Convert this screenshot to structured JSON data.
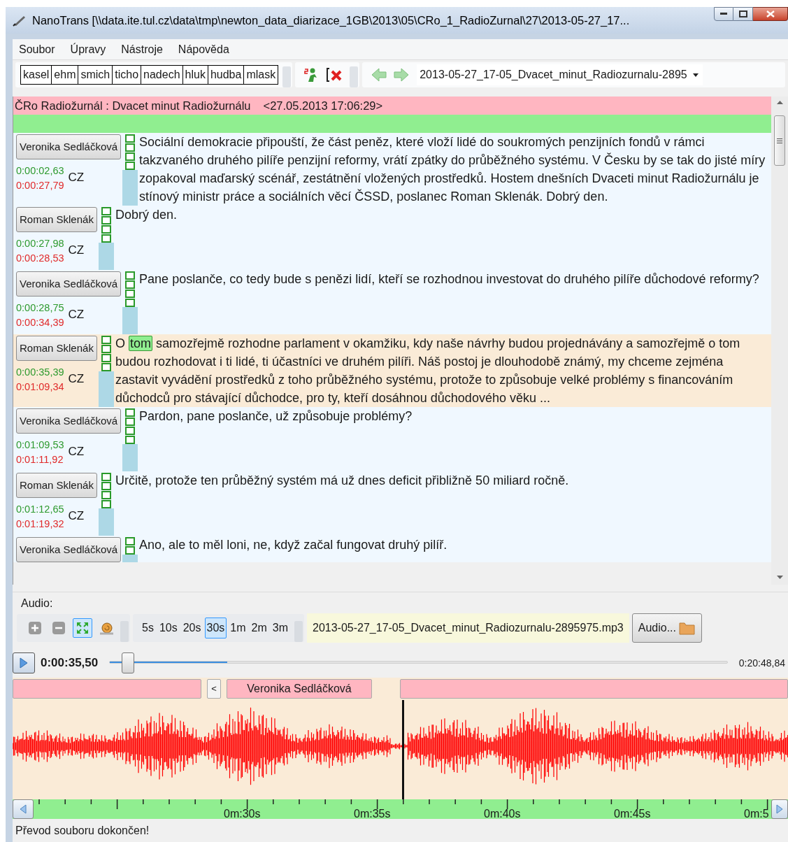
{
  "window": {
    "title": "NanoTrans [\\\\data.ite.tul.cz\\data\\tmp\\newton_data_diarizace_1GB\\2013\\05\\CRo_1_RadioZurnal\\27\\2013-05-27_17..."
  },
  "menu": [
    "Soubor",
    "Úpravy",
    "Nástroje",
    "Nápověda"
  ],
  "tag_buttons": [
    "kasel",
    "ehm",
    "smich",
    "ticho",
    "nadech",
    "hluk",
    "hudba",
    "mlask"
  ],
  "file_dropdown": {
    "value": "2013-05-27_17-05_Dvacet_minut_Radiozurnalu-2895"
  },
  "header": {
    "title": "ČRo Radiožurnál : Dvacet minut Radiožurnálu",
    "timestamp": "<27.05.2013 17:06:29>"
  },
  "segments": [
    {
      "speaker": "Veronika Sedláčková",
      "begin": "0:00:02,63",
      "end": "0:00:27,79",
      "language": "CZ",
      "selected": false,
      "checkboxes": [
        {
          "checked": false
        },
        {
          "checked": false
        },
        {
          "checked": false
        },
        {
          "checked": false
        }
      ],
      "parts": [
        {
          "text": "Sociální demokracie připouští, že část peněz, které vloží lidé do soukromých penzijních fondů v rámci takzvaného druhého pilíře penzijní reformy, vrátí zpátky do průběžného systému. V Česku by se tak do jisté míry zopakoval maďarský scénář, zestátnění vložených prostředků. Hostem dnešních Dvaceti minut Radiožurnálu je stínový ministr práce a sociálních věcí ČSSD, poslanec Roman Sklenák. Dobrý den.",
          "highlighted": false
        }
      ]
    },
    {
      "speaker": "Roman Sklenák",
      "begin": "0:00:27,98",
      "end": "0:00:28,53",
      "language": "CZ",
      "selected": false,
      "checkboxes": [
        {
          "checked": false
        },
        {
          "checked": false
        },
        {
          "checked": false
        },
        {
          "checked": false
        }
      ],
      "parts": [
        {
          "text": "Dobrý den.",
          "highlighted": false
        }
      ]
    },
    {
      "speaker": "Veronika Sedláčková",
      "begin": "0:00:28,75",
      "end": "0:00:34,39",
      "language": "CZ",
      "selected": false,
      "checkboxes": [
        {
          "checked": false
        },
        {
          "checked": false
        },
        {
          "checked": false
        },
        {
          "checked": false
        }
      ],
      "parts": [
        {
          "text": "Pane poslanče, co tedy bude s penězi lidí, kteří se rozhodnou investovat do druhého pilíře důchodové reformy?",
          "highlighted": false
        }
      ]
    },
    {
      "speaker": "Roman Sklenák",
      "begin": "0:00:35,39",
      "end": "0:01:09,34",
      "language": "CZ",
      "selected": true,
      "checkboxes": [
        {
          "checked": false
        },
        {
          "checked": false
        },
        {
          "checked": false
        },
        {
          "checked": false
        }
      ],
      "parts": [
        {
          "text": "O ",
          "highlighted": false
        },
        {
          "text": "tom",
          "highlighted": true
        },
        {
          "text": " samozřejmě rozhodne parlament v okamžiku, kdy naše návrhy budou projednávány a samozřejmě o tom budou rozhodovat i ti lidé, ti účastníci ve druhém pilíři. Náš postoj je dlouhodobě známý, my chceme zejména zastavit vyvádění prostředků z toho průběžného systému, protože to způsobuje velké problémy s financováním důchodců pro stávající důchodce, pro ty, kteří dosáhnou důchodového věku ...",
          "highlighted": false
        }
      ]
    },
    {
      "speaker": "Veronika Sedláčková",
      "begin": "0:01:09,53",
      "end": "0:01:11,92",
      "language": "CZ",
      "selected": false,
      "checkboxes": [
        {
          "checked": false
        },
        {
          "checked": false
        },
        {
          "checked": false
        },
        {
          "checked": false
        }
      ],
      "parts": [
        {
          "text": "Pardon, pane poslanče, už způsobuje problémy?",
          "highlighted": false
        }
      ]
    },
    {
      "speaker": "Roman Sklenák",
      "begin": "0:01:12,65",
      "end": "0:01:19,32",
      "language": "CZ",
      "selected": false,
      "checkboxes": [
        {
          "checked": false
        },
        {
          "checked": false
        },
        {
          "checked": false
        },
        {
          "checked": false
        }
      ],
      "parts": [
        {
          "text": "Určitě, protože ten průběžný systém má už dnes deficit přibližně 50 miliard ročně.",
          "highlighted": false
        }
      ]
    },
    {
      "speaker": "Veronika Sedláčková",
      "selected": false,
      "checkboxes": [
        {
          "checked": false
        },
        {
          "checked": false
        }
      ],
      "parts": [
        {
          "text": "Ano, ale to měl loni, ne, když začal fungovat druhý pilíř.",
          "highlighted": false
        }
      ]
    }
  ],
  "audio": {
    "label": "Audio:",
    "tools": [
      {
        "kind": "plus",
        "selected": false
      },
      {
        "kind": "minus",
        "selected": false
      },
      {
        "kind": "fit",
        "selected": true
      },
      {
        "kind": "snail",
        "selected": false
      }
    ],
    "zoom_steps": [
      {
        "label": "5s",
        "selected": false
      },
      {
        "label": "10s",
        "selected": false
      },
      {
        "label": "20s",
        "selected": false
      },
      {
        "label": "30s",
        "selected": true
      },
      {
        "label": "1m",
        "selected": false
      },
      {
        "label": "2m",
        "selected": false
      },
      {
        "label": "3m",
        "selected": false
      }
    ],
    "file": "2013-05-27_17-05_Dvacet_minut_Radiozurnalu-2895975.mp3",
    "open_button": "Audio..."
  },
  "playback": {
    "current_time": "0:00:35,50",
    "total_time": "0:20:48,84",
    "position": {
      "level": 0.025
    },
    "view_range": {
      "level": 0.19
    }
  },
  "speaker_track": {
    "back_button": "<",
    "speaker": "Veronika Sedláčková"
  },
  "timeline": {
    "labels": [
      "0m:30s",
      "0m:35s",
      "0m:40s",
      "0m:45s",
      "0m:5"
    ]
  },
  "status_bar": "Převod souboru dokončen!"
}
